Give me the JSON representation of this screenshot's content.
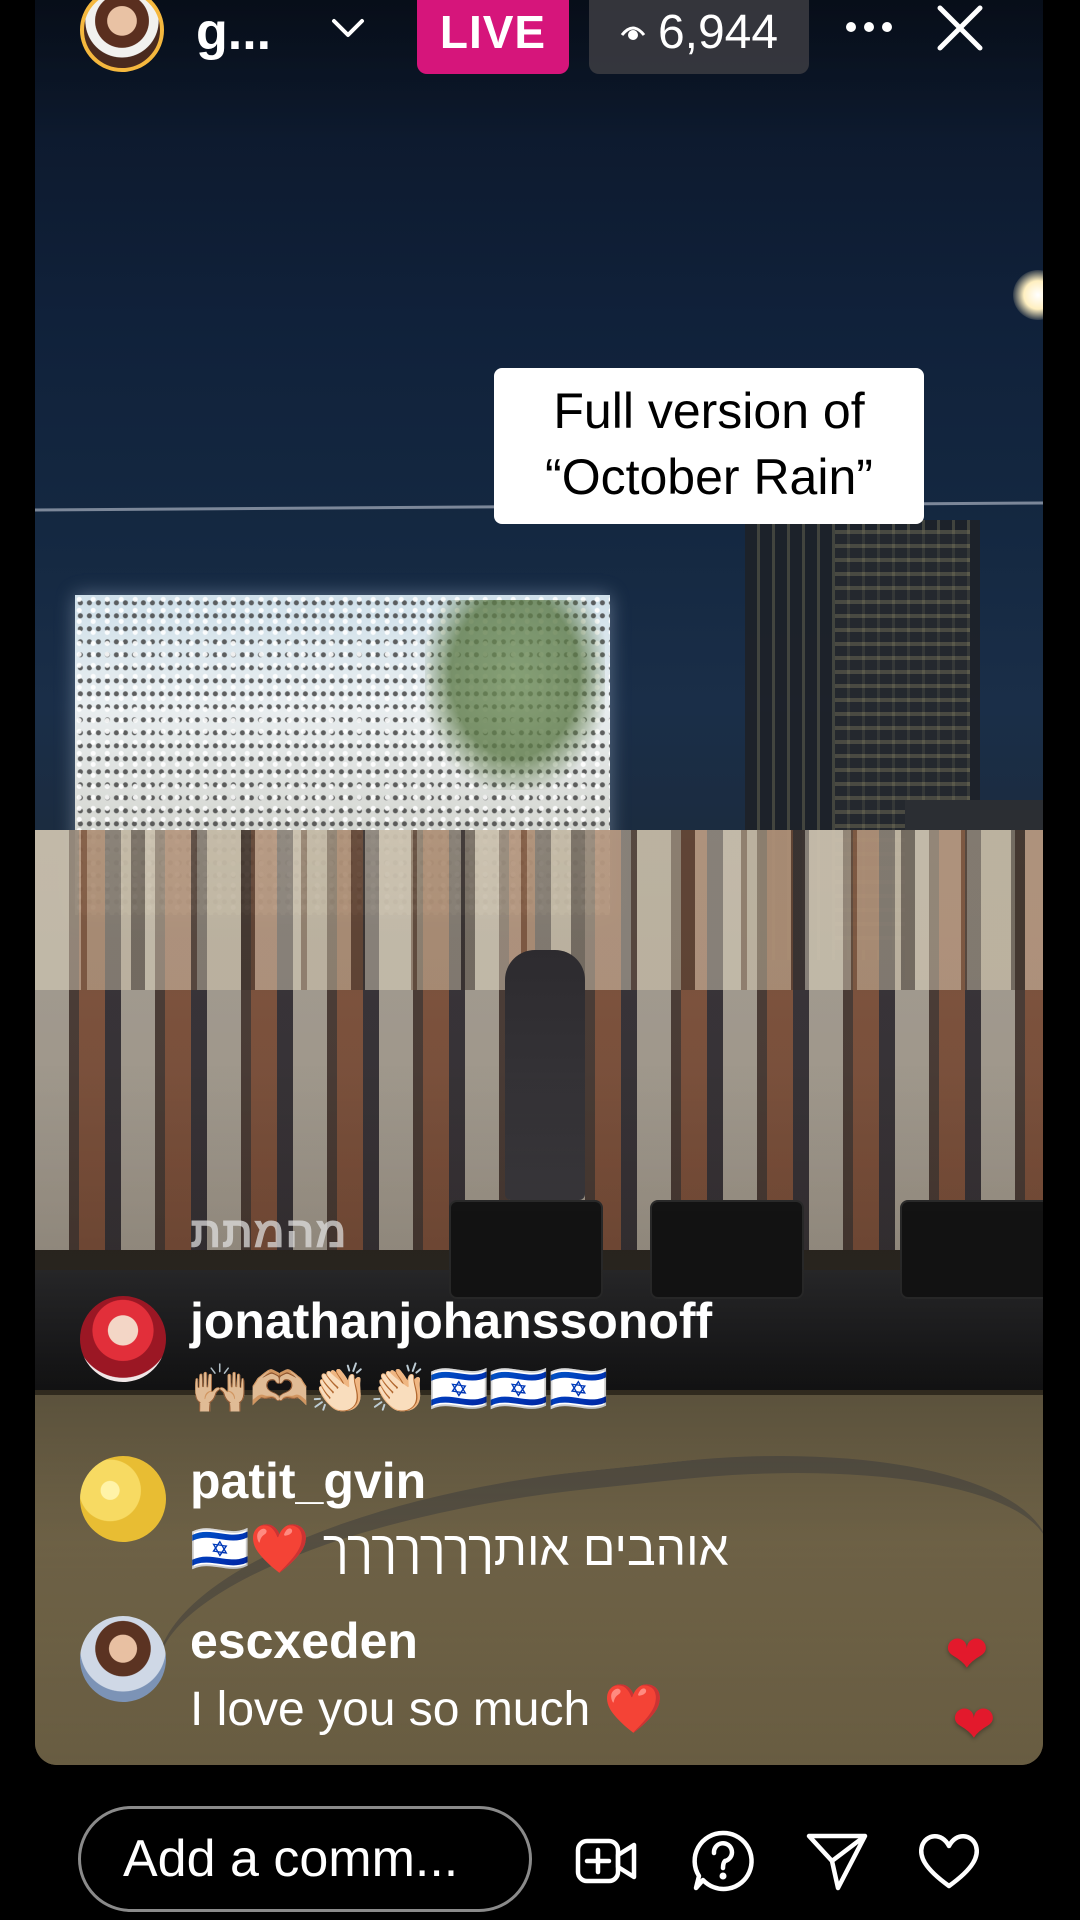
{
  "header": {
    "host_name": "g...",
    "live_label": "LIVE",
    "viewer_count": "6,944"
  },
  "caption": {
    "line1": "Full version of",
    "line2": "“October Rain”"
  },
  "overlay_label": "מהמתת",
  "comments": [
    {
      "username": "jonathanjohanssonoff",
      "text": "🙌🏼🫶🏼👏🏻👏🏻🇮🇱🇮🇱🇮🇱"
    },
    {
      "username": "patit_gvin",
      "text": "אוהבים אותךךךךךךך",
      "prefix_emoji": "🇮🇱❤️"
    },
    {
      "username": "escxeden",
      "text": "I love you so much",
      "suffix_emoji": "❤️"
    }
  ],
  "bottom_bar": {
    "comment_placeholder": "Add a comm...",
    "icons": [
      "add-video-icon",
      "question-icon",
      "send-icon",
      "heart-icon"
    ]
  },
  "colors": {
    "live_badge": "#d6157b",
    "heart": "#e3192c"
  }
}
